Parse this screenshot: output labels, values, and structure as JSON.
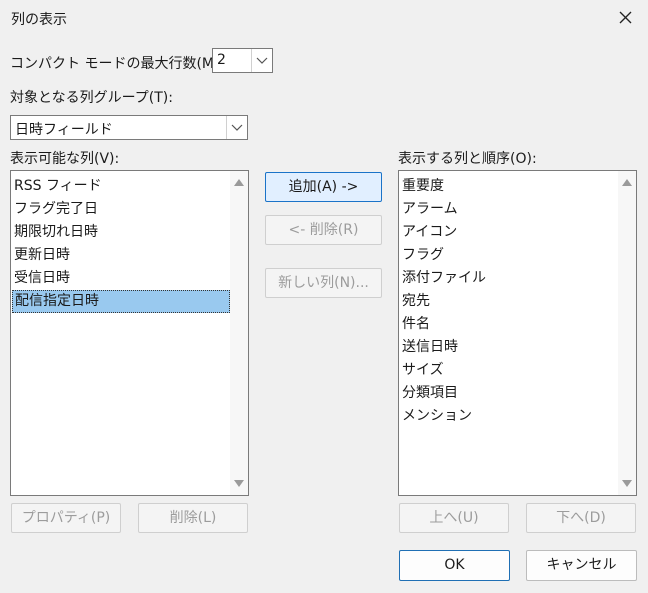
{
  "window": {
    "title": "列の表示"
  },
  "compact": {
    "label": "コンパクト モードの最大行数(M):",
    "value": "2"
  },
  "group": {
    "label": "対象となる列グループ(T):",
    "value": "日時フィールド"
  },
  "available": {
    "label": "表示可能な列(V):",
    "items": [
      "RSS フィード",
      "フラグ完了日",
      "期限切れ日時",
      "更新日時",
      "受信日時",
      "配信指定日時"
    ],
    "selected_index": 5
  },
  "shown": {
    "label": "表示する列と順序(O):",
    "items": [
      "重要度",
      "アラーム",
      "アイコン",
      "フラグ",
      "添付ファイル",
      "宛先",
      "件名",
      "送信日時",
      "サイズ",
      "分類項目",
      "メンション"
    ]
  },
  "buttons": {
    "add": "追加(A) ->",
    "remove": "<- 削除(R)",
    "new_column": "新しい列(N)...",
    "properties": "プロパティ(P)",
    "delete": "削除(L)",
    "move_up": "上へ(U)",
    "move_down": "下へ(D)",
    "ok": "OK",
    "cancel": "キャンセル"
  }
}
